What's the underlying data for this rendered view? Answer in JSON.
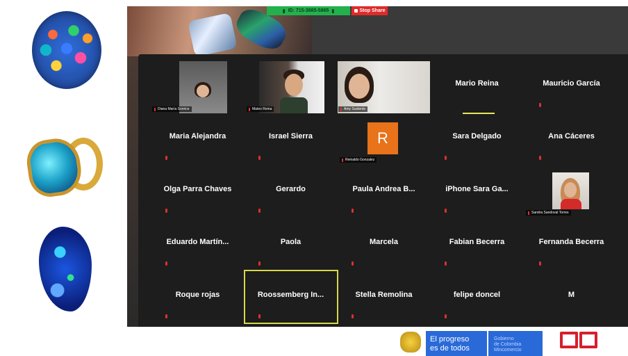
{
  "share_bar": {
    "meeting_id": "ID: 715-3885-5865",
    "stop_share_label": "Stop Share"
  },
  "participants": {
    "video": [
      {
        "name": "Diana María Sonrice"
      },
      {
        "name": "Mateo Reina"
      },
      {
        "name": "Amy Sustento"
      },
      {
        "name": "Sandra Sandoval Torres"
      }
    ],
    "avatar_letter": "R",
    "avatar_name": "Reinaldo Gonzalez",
    "tiles": [
      "Mario Reina",
      "Mauricio García",
      "Maria Alejandra",
      "Israel Sierra",
      "Sara Delgado",
      "Ana Cáceres",
      "Olga Parra Chaves",
      "Gerardo",
      "Paula Andrea B...",
      "iPhone Sara Ga...",
      "Eduardo Martín...",
      "Paola",
      "Marcela",
      "Fabian Becerra",
      "Fernanda Becerra",
      "Roque rojas",
      "Roossemberg In...",
      "Stella Remolina",
      "felipe doncel",
      "M"
    ]
  },
  "footer": {
    "progreso_line1": "El progreso",
    "progreso_line2": "es de todos",
    "gob_line1": "Gobierno",
    "gob_line2": "de Colombia",
    "gob_line3": "Mincomercio"
  },
  "colors": {
    "accent_orange": "#e8731a",
    "share_green": "#23b14d",
    "stop_red": "#e02a2a",
    "active_yellow": "#d8d84a"
  }
}
